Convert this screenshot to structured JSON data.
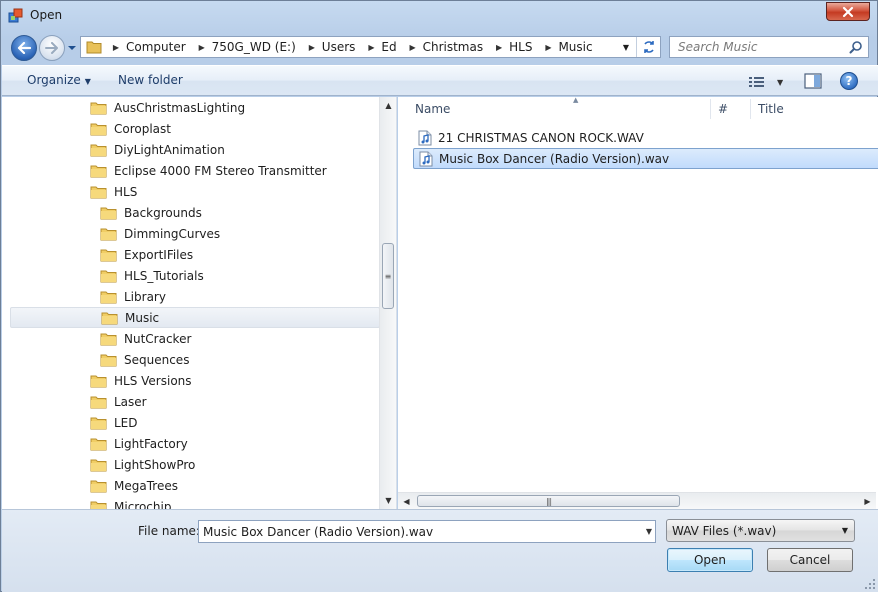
{
  "window": {
    "title": "Open"
  },
  "address": {
    "crumbs": [
      "Computer",
      "750G_WD (E:)",
      "Users",
      "Ed",
      "Christmas",
      "HLS",
      "Music"
    ]
  },
  "search": {
    "placeholder": "Search Music"
  },
  "toolbar": {
    "organize": "Organize",
    "new_folder": "New folder",
    "help": "?"
  },
  "tree": {
    "items": [
      {
        "label": "AusChristmasLighting",
        "level": 1
      },
      {
        "label": "Coroplast",
        "level": 1
      },
      {
        "label": "DiyLightAnimation",
        "level": 1
      },
      {
        "label": "Eclipse 4000 FM Stereo Transmitter",
        "level": 1
      },
      {
        "label": "HLS",
        "level": 1
      },
      {
        "label": "Backgrounds",
        "level": 2
      },
      {
        "label": "DimmingCurves",
        "level": 2
      },
      {
        "label": "ExportIFiles",
        "level": 2
      },
      {
        "label": "HLS_Tutorials",
        "level": 2
      },
      {
        "label": "Library",
        "level": 2
      },
      {
        "label": "Music",
        "level": 2,
        "selected": true
      },
      {
        "label": "NutCracker",
        "level": 2
      },
      {
        "label": "Sequences",
        "level": 2
      },
      {
        "label": "HLS Versions",
        "level": 1
      },
      {
        "label": "Laser",
        "level": 1
      },
      {
        "label": "LED",
        "level": 1
      },
      {
        "label": "LightFactory",
        "level": 1
      },
      {
        "label": "LightShowPro",
        "level": 1
      },
      {
        "label": "MegaTrees",
        "level": 1
      },
      {
        "label": "Microchip",
        "level": 1
      }
    ]
  },
  "columns": {
    "name": "Name",
    "number": "#",
    "title": "Title"
  },
  "files": [
    {
      "label": "21 CHRISTMAS CANON ROCK.WAV",
      "selected": false
    },
    {
      "label": "Music Box Dancer (Radio Version).wav",
      "selected": true
    }
  ],
  "bottom": {
    "file_name_label": "File name:",
    "file_name_value": "Music Box Dancer (Radio Version).wav",
    "file_type": "WAV Files (*.wav)",
    "open_label": "Open",
    "cancel_label": "Cancel"
  }
}
